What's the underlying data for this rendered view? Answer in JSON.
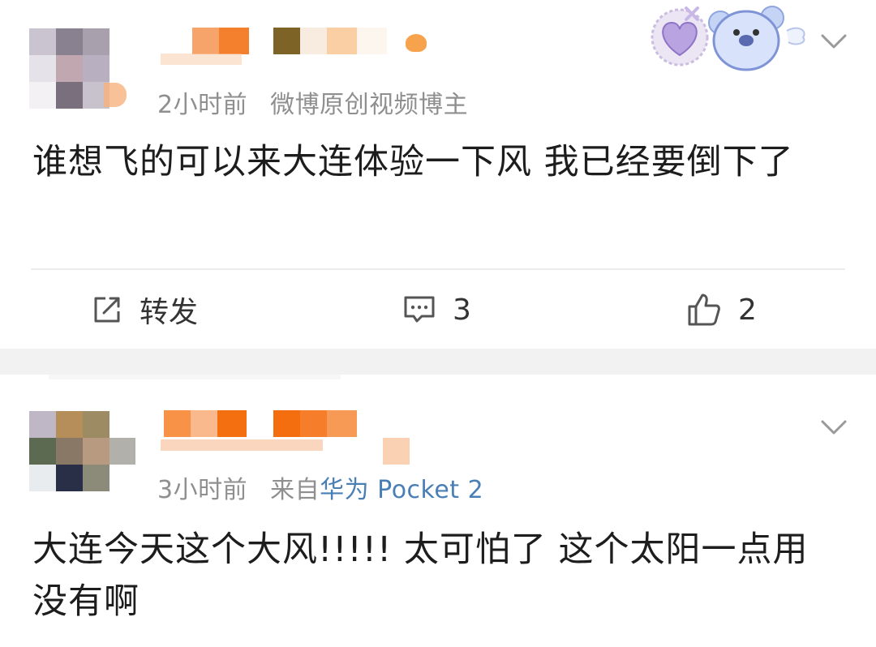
{
  "post1": {
    "time": "2小时前",
    "source": "微博原创视频博主",
    "text": "谁想飞的可以来大连体验一下风 我已经要倒下了",
    "actions": {
      "repost_label": "转发",
      "comment_count": "3",
      "like_count": "2"
    }
  },
  "post2": {
    "time": "3小时前",
    "source_prefix": "来自",
    "device": "华为 Pocket 2",
    "text": "大连今天这个大风!!!!! 太可怕了 这个太阳一点用没有啊"
  },
  "icons": [
    "chevron-down-icon",
    "repost-icon",
    "comment-icon",
    "like-icon",
    "sticker-heart-icon",
    "sticker-koala-icon"
  ]
}
